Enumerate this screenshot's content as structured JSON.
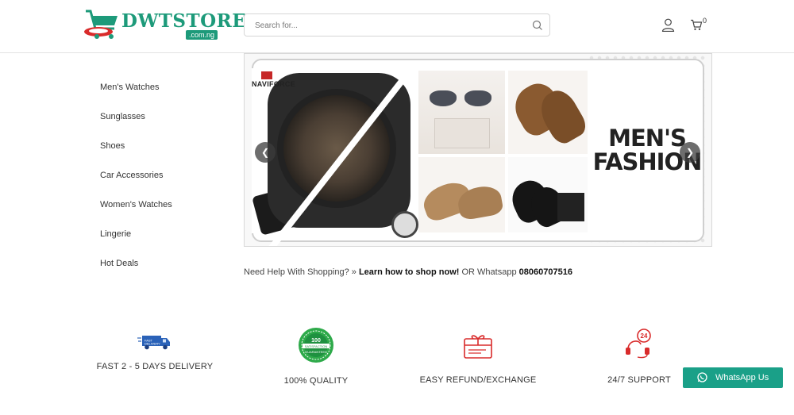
{
  "header": {
    "logo_text": "DWTSTORE",
    "logo_domain": ".com.ng",
    "search_placeholder": "Search for...",
    "cart_count": "0"
  },
  "sidebar": {
    "items": [
      {
        "label": "Men's Watches"
      },
      {
        "label": "Sunglasses"
      },
      {
        "label": "Shoes"
      },
      {
        "label": "Car Accessories"
      },
      {
        "label": "Women's Watches"
      },
      {
        "label": "Lingerie"
      },
      {
        "label": "Hot Deals"
      }
    ]
  },
  "banner": {
    "brand": "NAVIFORCE",
    "headline_line1": "MEN'S",
    "headline_line2": "FASHION",
    "prev_arrow": "❮",
    "next_arrow": "❯"
  },
  "help": {
    "prefix": "Need Help With Shopping? » ",
    "link": "Learn how to shop now!",
    "middle": " OR Whatsapp ",
    "phone": "08060707516"
  },
  "features": [
    {
      "label": "FAST 2 - 5 DAYS DELIVERY",
      "icon": "delivery-truck-icon"
    },
    {
      "label": "100% QUALITY",
      "icon": "quality-badge-icon"
    },
    {
      "label": "EASY REFUND/EXCHANGE",
      "icon": "gift-card-icon"
    },
    {
      "label": "24/7 SUPPORT",
      "icon": "support-headset-icon"
    }
  ],
  "whatsapp": {
    "label": "WhatsApp Us"
  },
  "colors": {
    "brand_green": "#1d9a7a",
    "whatsapp_green": "#1aa088",
    "accent_red": "#d92b2b"
  }
}
